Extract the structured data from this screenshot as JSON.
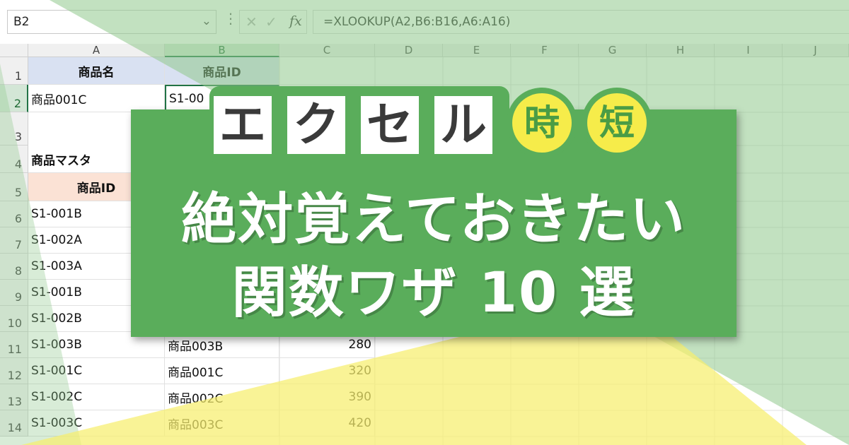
{
  "formula_bar": {
    "name_box": "B2",
    "name_box_caret": "⌄",
    "more_dots": "⋮",
    "cancel_icon": "✕",
    "enter_icon": "✓",
    "fx_label": "fx",
    "formula": "=XLOOKUP(A2,B6:B16,A6:A16)"
  },
  "sheet": {
    "columns": [
      "A",
      "B",
      "C",
      "D",
      "E",
      "F",
      "G",
      "H",
      "I",
      "J"
    ],
    "selected_column": "B",
    "rows": [
      "1",
      "2",
      "3",
      "4",
      "5",
      "6",
      "7",
      "8",
      "9",
      "10",
      "11",
      "12",
      "13",
      "14"
    ],
    "selected_row": "2",
    "header_name": "商品名",
    "header_id": "商品ID",
    "a2": "商品001C",
    "b2": "S1-00",
    "master_title": "商品マスタ",
    "master_header_id": "商品ID",
    "master_ids": [
      "S1-001B",
      "S1-002A",
      "S1-003A",
      "S1-001B",
      "S1-002B",
      "S1-003B",
      "S1-001C",
      "S1-002C",
      "S1-003C"
    ],
    "master_rows_visible": [
      {
        "name": "商品003B",
        "price": "280"
      },
      {
        "name": "商品001C",
        "price": "320"
      },
      {
        "name": "商品002C",
        "price": "390"
      },
      {
        "name": "商品003C",
        "price": "420"
      }
    ]
  },
  "banner": {
    "tag_chars": [
      "エ",
      "ク",
      "セ",
      "ル"
    ],
    "circle_chars": [
      "時",
      "短"
    ],
    "title_line1": "絶対覚えておきたい",
    "title_line2": "関数ワザ 10 選"
  },
  "colors": {
    "banner_green": "#5aad5b",
    "accent_yellow": "#f6ec4a",
    "excel_green": "#217346",
    "triangle_green": "#8fc98c",
    "triangle_yellow": "#f7ef6e"
  }
}
